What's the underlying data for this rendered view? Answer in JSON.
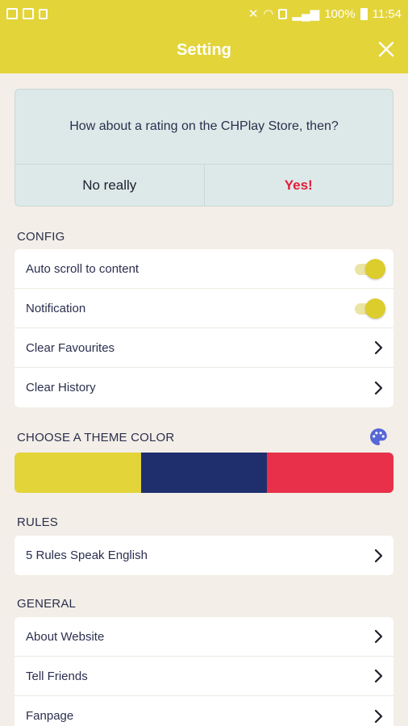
{
  "statusbar": {
    "battery_percent": "100%",
    "time": "11:54"
  },
  "appbar": {
    "title": "Setting"
  },
  "rating": {
    "question": "How about a rating on the CHPlay Store, then?",
    "no_label": "No really",
    "yes_label": "Yes!"
  },
  "config": {
    "header": "CONFIG",
    "items": [
      {
        "label": "Auto scroll to content",
        "toggle": true
      },
      {
        "label": "Notification",
        "toggle": true
      },
      {
        "label": "Clear Favourites"
      },
      {
        "label": "Clear History"
      }
    ]
  },
  "theme": {
    "header": "CHOOSE A THEME COLOR",
    "colors": [
      "#e3d43a",
      "#1f2f6e",
      "#e8304a"
    ]
  },
  "rules": {
    "header": "RULES",
    "items": [
      {
        "label": "5 Rules Speak English"
      }
    ]
  },
  "general": {
    "header": "GENERAL",
    "items": [
      {
        "label": "About Website"
      },
      {
        "label": "Tell Friends"
      },
      {
        "label": "Fanpage"
      }
    ]
  },
  "icons": {
    "close": "close-icon",
    "chevron": "chevron-right-icon",
    "palette": "palette-icon"
  },
  "accent_color": "#e3d43a"
}
